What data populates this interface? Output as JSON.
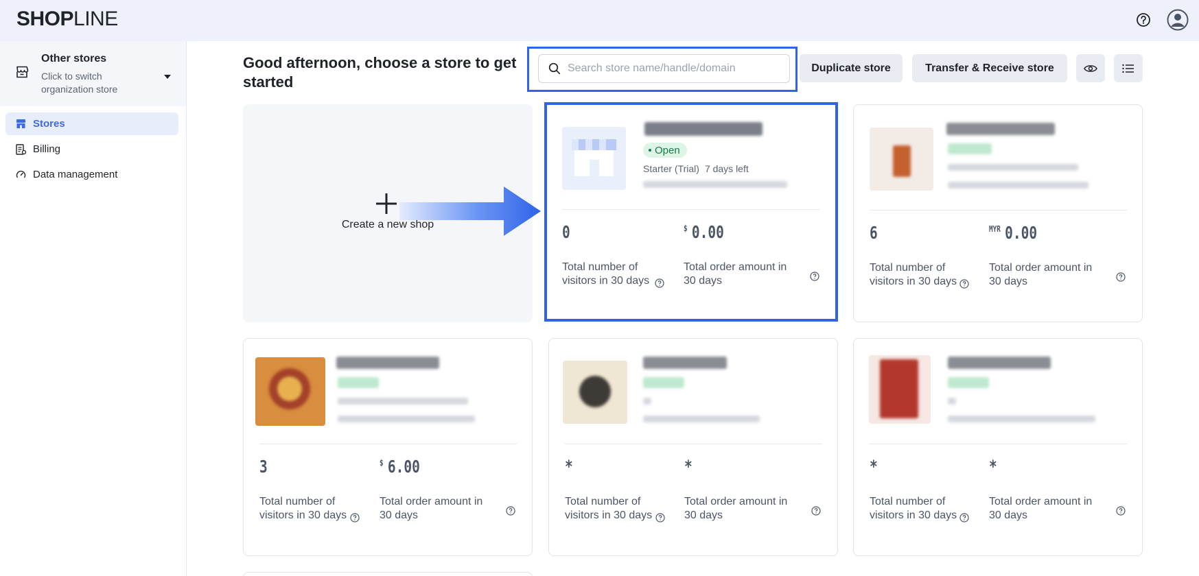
{
  "brand": {
    "logo_bold": "SHOP",
    "logo_thin": "LINE"
  },
  "topbar": {
    "help_icon": "help-circle-icon",
    "user_icon": "user-avatar-icon"
  },
  "sidebar": {
    "org_title": "Other stores",
    "org_subtitle": "Click to switch organization store",
    "items": [
      {
        "label": "Stores",
        "icon": "store-icon",
        "active": true
      },
      {
        "label": "Billing",
        "icon": "billing-icon",
        "active": false
      },
      {
        "label": "Data management",
        "icon": "gauge-icon",
        "active": false
      }
    ]
  },
  "header": {
    "greeting": "Good afternoon, choose a store to get started",
    "search_placeholder": "Search store name/handle/domain",
    "search_value": "",
    "duplicate_label": "Duplicate store",
    "transfer_label": "Transfer & Receive store",
    "view_icon": "eye-icon",
    "list_icon": "list-icon"
  },
  "create_card": {
    "label": "Create a new shop"
  },
  "metric_labels": {
    "visitors": "Total number of visitors in 30 days",
    "orders": "Total order amount in 30 days"
  },
  "stores": [
    {
      "status": "Open",
      "plan": "Starter (Trial)",
      "days_left": "7 days left",
      "visitors": "0",
      "currency": "$",
      "amount": "0.00",
      "highlighted": true
    },
    {
      "visitors": "6",
      "currency": "MYR",
      "amount": "0.00"
    },
    {
      "visitors": "3",
      "currency": "$",
      "amount": "6.00"
    },
    {
      "visitors": "*",
      "currency": "",
      "amount": "*"
    },
    {
      "visitors": "*",
      "currency": "",
      "amount": "*"
    }
  ],
  "colors": {
    "accent": "#2f64e8",
    "open_badge_bg": "#dcf5e6",
    "open_badge_text": "#1a7b45"
  }
}
